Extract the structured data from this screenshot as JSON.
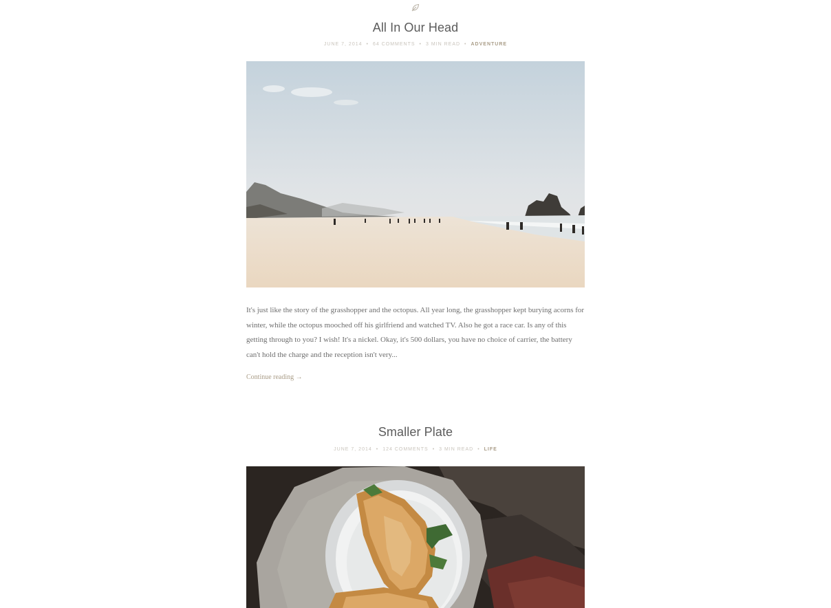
{
  "colors": {
    "title": "#5b5b5b",
    "meta": "#c9c4bc",
    "accent": "#a99c87",
    "body_text": "#6d6d6d"
  },
  "header": {
    "icon": "leaf-icon"
  },
  "posts": [
    {
      "title": "All In Our Head",
      "date": "JUNE 7, 2014",
      "comments": "64 COMMENTS",
      "read_time": "3 MIN READ",
      "category": "ADVENTURE",
      "image": "beach-landscape-photo",
      "excerpt": "It's just like the story of the grasshopper and the octopus. All year long, the grasshopper kept burying acorns for winter, while the octopus mooched off his girlfriend and watched TV. Also he got a race car. Is any of this getting through to you? I wish! It's a nickel. Okay, it's 500 dollars, you have no choice of carrier, the battery can't hold the charge and the reception isn't very...",
      "continue_label": "Continue reading →"
    },
    {
      "title": "Smaller Plate",
      "date": "JUNE 7, 2014",
      "comments": "124 COMMENTS",
      "read_time": "3 MIN READ",
      "category": "LIFE",
      "image": "toast-on-plate-photo"
    }
  ]
}
